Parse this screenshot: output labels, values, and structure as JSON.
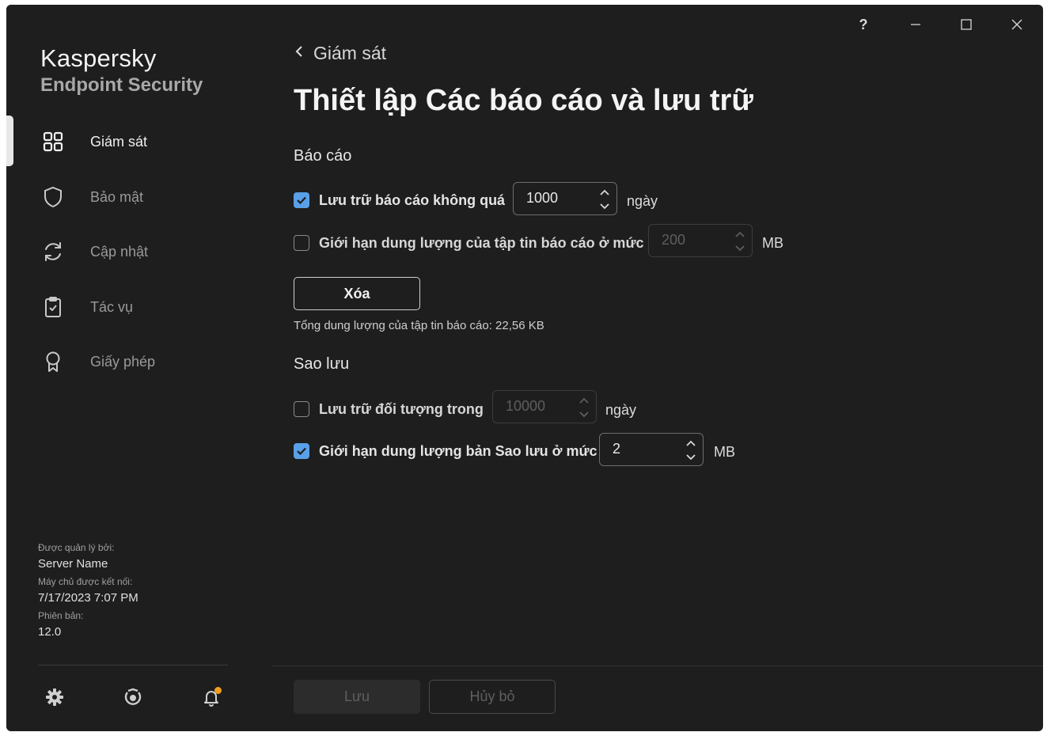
{
  "window": {
    "controls": [
      "help-icon",
      "minimize-icon",
      "maximize-icon",
      "close-icon"
    ],
    "help_label": "?"
  },
  "brand": {
    "name": "Kaspersky",
    "product": "Endpoint Security"
  },
  "sidebar": {
    "items": [
      {
        "label": "Giám sát",
        "icon": "dashboard-icon",
        "active": true
      },
      {
        "label": "Bảo mật",
        "icon": "shield-icon",
        "active": false
      },
      {
        "label": "Cập nhật",
        "icon": "refresh-icon",
        "active": false
      },
      {
        "label": "Tác vụ",
        "icon": "clipboard-icon",
        "active": false
      },
      {
        "label": "Giấy phép",
        "icon": "license-ribbon-icon",
        "active": false
      }
    ],
    "managed": {
      "managed_by_label": "Được quản lý bởi:",
      "server_name": "Server Name",
      "connected_label": "Máy chủ được kết nối:",
      "connected_time": "7/17/2023 7:07 PM",
      "version_label": "Phiên bản:",
      "version": "12.0"
    },
    "bottom_icons": [
      "settings-gear-icon",
      "support-icon",
      "notifications-bell-icon"
    ]
  },
  "main": {
    "back_label": "Giám sát",
    "title": "Thiết lập Các báo cáo và lưu trữ",
    "reports": {
      "heading": "Báo cáo",
      "store_reports": {
        "label": "Lưu trữ báo cáo không quá",
        "checked": true,
        "value": "1000",
        "unit": "ngày"
      },
      "limit_report_size": {
        "label": "Giới hạn dung lượng của tập tin báo cáo ở mức",
        "checked": false,
        "value": "200",
        "unit": "MB"
      },
      "delete_label": "Xóa",
      "total_size": "Tổng dung lượng của tập tin báo cáo: 22,56 KB"
    },
    "backup": {
      "heading": "Sao lưu",
      "store_objects": {
        "label": "Lưu trữ đối tượng trong",
        "checked": false,
        "value": "10000",
        "unit": "ngày"
      },
      "limit_backup_size": {
        "label": "Giới hạn dung lượng bản Sao lưu ở mức",
        "checked": true,
        "value": "2",
        "unit": "MB"
      }
    },
    "footer": {
      "save_label": "Lưu",
      "cancel_label": "Hủy bỏ"
    }
  },
  "colors": {
    "background": "#1e1e1e",
    "accent": "#5aa0e8",
    "notification": "#f0a020"
  }
}
